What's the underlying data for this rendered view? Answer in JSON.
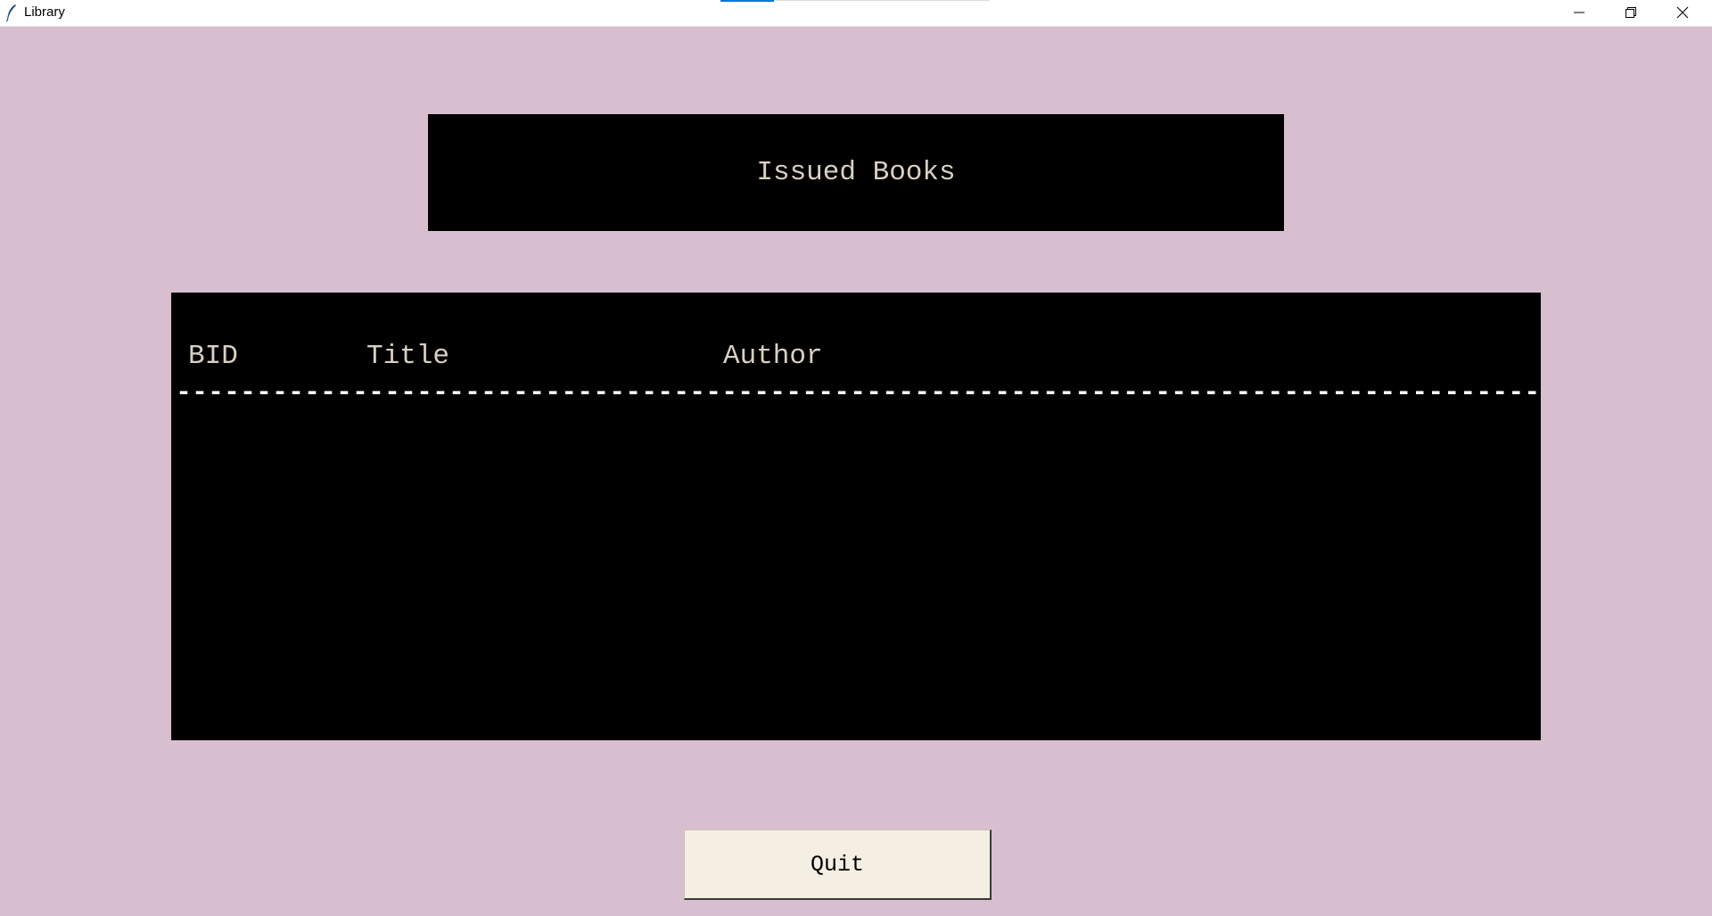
{
  "window": {
    "title": "Library",
    "icons": {
      "app": "feather-icon",
      "minimize": "minimize-icon",
      "maximize": "restore-icon",
      "close": "close-icon"
    }
  },
  "heading": {
    "title": "Issued Books"
  },
  "table": {
    "columns": [
      "BID",
      "Title",
      "Author"
    ],
    "divider": "----------------------------------------------------------------------------------------------",
    "rows": []
  },
  "buttons": {
    "quit_label": "Quit"
  },
  "colors": {
    "background": "#d8bfd0",
    "panel": "#000000",
    "panel_text": "#d8d0c4",
    "button_bg": "#f5efe3"
  }
}
